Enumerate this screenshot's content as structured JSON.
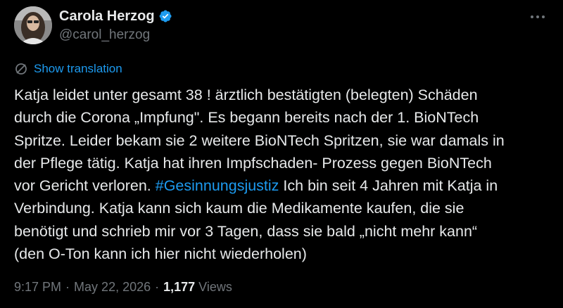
{
  "author": {
    "display_name": "Carola Herzog",
    "handle": "@carol_herzog",
    "verified": true
  },
  "translate": {
    "label": "Show translation",
    "icon": "globe-icon"
  },
  "tweet": {
    "lines": [
      "Katja leidet unter gesamt 38 ! ärztlich bestätigten (belegten) Schäden",
      "durch die Corona „Impfung\". Es begann bereits nach der 1. BioNTech",
      "Spritze. Leider bekam sie 2 weitere BioNTech Spritzen, sie war damals in",
      "der Pflege tätig. Katja hat ihren Impfschaden- Prozess gegen BioNTech",
      "vor Gericht verloren.",
      " Ich bin seit 4 Jahren mit Katja in",
      "Verbindung. Katja kann sich kaum die Medikamente kaufen, die sie",
      "benötigt und schrieb mir vor 3 Tagen, dass sie bald „nicht mehr kann“",
      "(den O-Ton kann ich hier nicht wiederholen)"
    ],
    "hashtag": "#Gesinnungsjustiz"
  },
  "meta": {
    "time": "9:17 PM",
    "separator": "·",
    "date": "May 22, 2026",
    "views_count": "1,177",
    "views_label": "Views"
  },
  "colors": {
    "background": "#000000",
    "text": "#e7e9ea",
    "muted": "#71767b",
    "accent": "#1d9bf0"
  }
}
